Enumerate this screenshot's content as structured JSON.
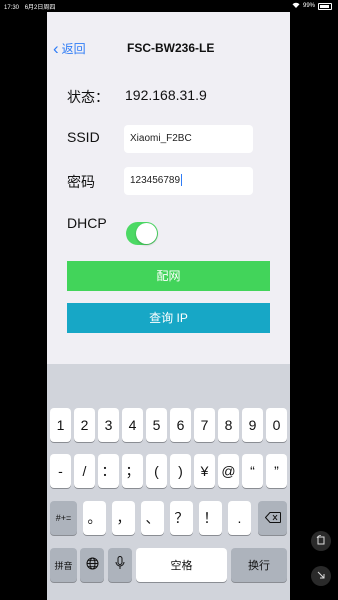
{
  "status_bar": {
    "time": "17:30",
    "date": "6月2日周四",
    "battery": "99%"
  },
  "nav": {
    "back_label": "返回",
    "title": "FSC-BW236-LE"
  },
  "form": {
    "status_label": "状态：",
    "status_value": "192.168.31.9",
    "ssid_label": "SSID",
    "ssid_value": "Xiaomi_F2BC",
    "password_label": "密码",
    "password_value": "123456789",
    "dhcp_label": "DHCP",
    "dhcp_on": true
  },
  "buttons": {
    "config": "配网",
    "query_ip": "查询 IP"
  },
  "keyboard": {
    "row1": [
      "1",
      "2",
      "3",
      "4",
      "5",
      "6",
      "7",
      "8",
      "9",
      "0"
    ],
    "row2": [
      "-",
      "/",
      "：",
      "；",
      "(",
      ")",
      "¥",
      "@",
      "“",
      "”"
    ],
    "row3_left": "#+=",
    "row3": [
      "。",
      "，",
      "、",
      "？",
      "！",
      "."
    ],
    "row4": {
      "lang": "拼音",
      "space": "空格",
      "return": "换行"
    }
  },
  "colors": {
    "accent_blue": "#2f7cf6",
    "green": "#42d45a",
    "teal": "#17a7c6",
    "toggle_on": "#4cd964"
  },
  "icons": [
    "chevron-left-icon",
    "wifi-icon",
    "battery-icon",
    "globe-icon",
    "microphone-icon",
    "backspace-icon",
    "rotate-icon",
    "minimize-icon"
  ]
}
